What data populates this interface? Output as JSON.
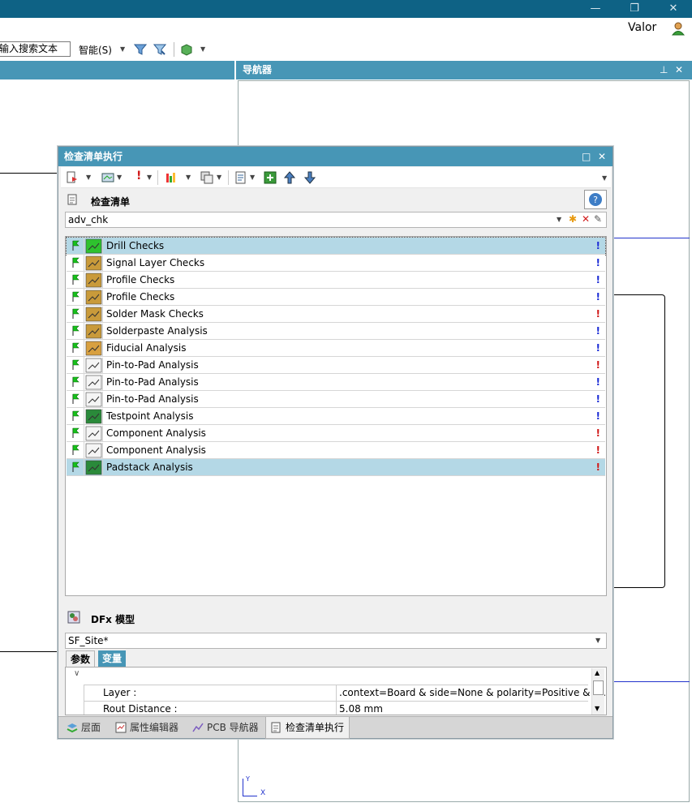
{
  "window": {
    "minimize": "—",
    "restore": "❐",
    "close": "✕"
  },
  "user": {
    "name": "Valor"
  },
  "toolbar": {
    "search_placeholder": "输入搜索文本",
    "smart_label": "智能(S)"
  },
  "navigator": {
    "title": "导航器",
    "axis_y": "Y",
    "axis_x": "X"
  },
  "dialog": {
    "title": "检查清单执行",
    "checklist_section": "检查清单",
    "checklist_value": "adv_chk",
    "items": [
      {
        "label": "Drill Checks",
        "severity_color": "#1f2fd6",
        "selected": true
      },
      {
        "label": "Signal Layer Checks",
        "severity_color": "#1f2fd6",
        "selected": false
      },
      {
        "label": "Profile Checks",
        "severity_color": "#1f2fd6",
        "selected": false
      },
      {
        "label": "Profile Checks",
        "severity_color": "#1f2fd6",
        "selected": false
      },
      {
        "label": "Solder Mask Checks",
        "severity_color": "#d11c1c",
        "selected": false
      },
      {
        "label": "Solderpaste Analysis",
        "severity_color": "#1f2fd6",
        "selected": false
      },
      {
        "label": "Fiducial Analysis",
        "severity_color": "#1f2fd6",
        "selected": false
      },
      {
        "label": "Pin-to-Pad Analysis",
        "severity_color": "#d11c1c",
        "selected": false
      },
      {
        "label": "Pin-to-Pad Analysis",
        "severity_color": "#1f2fd6",
        "selected": false
      },
      {
        "label": "Pin-to-Pad Analysis",
        "severity_color": "#1f2fd6",
        "selected": false
      },
      {
        "label": "Testpoint Analysis",
        "severity_color": "#1f2fd6",
        "selected": false
      },
      {
        "label": "Component Analysis",
        "severity_color": "#d11c1c",
        "selected": false
      },
      {
        "label": "Component Analysis",
        "severity_color": "#d11c1c",
        "selected": false
      },
      {
        "label": "Padstack Analysis",
        "severity_color": "#d11c1c",
        "selected": true
      }
    ],
    "severity_symbol": "!",
    "dfx_section": "DFx 模型",
    "dfx_value": "SF_Site*",
    "tab_params": "参数",
    "tab_vars": "变量",
    "props": [
      {
        "name": "Layer :",
        "value": ".context=Board & side=None & polarity=Positive & ty…"
      },
      {
        "name": "Rout Distance :",
        "value": "5.08 mm"
      }
    ],
    "bottom_tabs": [
      "层面",
      "属性编辑器",
      "PCB 导航器",
      "检查清单执行"
    ]
  }
}
